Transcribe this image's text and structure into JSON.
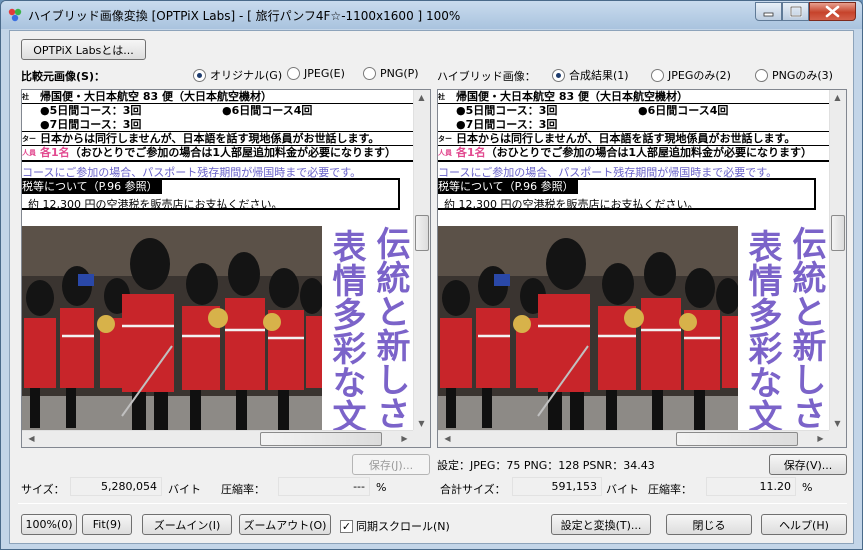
{
  "titlebar": {
    "title": "ハイブリッド画像変換 [OPTPiX Labs] - [ 旅行パンフ4F☆-1100x1600 ] 100%"
  },
  "toolbar": {
    "about_label": "OPTPiX Labsとは..."
  },
  "left": {
    "section_label": "比較元画像(S)：",
    "radios": [
      {
        "label": "オリジナル(G)",
        "selected": true
      },
      {
        "label": "JPEG(E)",
        "selected": false
      },
      {
        "label": "PNG(P)",
        "selected": false
      }
    ],
    "save_label": "保存(J)...",
    "size_label": "サイズ：",
    "size_value": "5,280,054",
    "size_unit": "バイト",
    "ratio_label": "圧縮率：",
    "ratio_value": "---",
    "ratio_unit": "%"
  },
  "right": {
    "section_label": "ハイブリッド画像：",
    "radios": [
      {
        "label": "合成結果(1)",
        "selected": true
      },
      {
        "label": "JPEGのみ(2)",
        "selected": false
      },
      {
        "label": "PNGのみ(3)",
        "selected": false
      }
    ],
    "settings_text": "設定：JPEG：75  PNG：128  PSNR：34.43",
    "save_label": "保存(V)...",
    "size_label": "合計サイズ：",
    "size_value": "591,153",
    "size_unit": "バイト",
    "ratio_label": "圧縮率：",
    "ratio_value": "11.20",
    "ratio_unit": "%"
  },
  "document": {
    "row1_tag": "社",
    "row1_text": "帰国便・大日本航空 83 便（大日本航空機材）",
    "row2_text_a": "●5日間コース：3回",
    "row2_text_b": "●6日間コース4回",
    "row3_text": "●7日間コース：3回",
    "row4_tag": "ター",
    "row4_text": "日本からは同行しませんが、日本語を話す現地係員がお世話します。",
    "row5_tag": "人員",
    "row5_highlight": "各1名",
    "row5_text": "（おひとりでご参加の場合は1人部屋追加料金が必要になります）",
    "notice": "コースにご参加の場合、パスポート残存期間が帰国時まで必要です。",
    "tax_head": "税等について（P.96 参照）",
    "tax_body": "約 12,300 円の空港税を販売店にお支払ください。",
    "vtext_col1": "伝統と新しさ",
    "vtext_col2": "表情多彩な文"
  },
  "bottom": {
    "zoom100_label": "100%(0)",
    "fit_label": "Fit(9)",
    "zoomin_label": "ズームイン(I)",
    "zoomout_label": "ズームアウト(O)",
    "sync_label": "同期スクロール(N)",
    "sync_checked": true,
    "settings_label": "設定と変換(T)...",
    "close_label": "閉じる",
    "help_label": "ヘルプ(H)"
  },
  "colors": {
    "accent_purple": "#7b63c9",
    "highlight_pink": "#e24a90",
    "guard_red": "#c8252a"
  }
}
